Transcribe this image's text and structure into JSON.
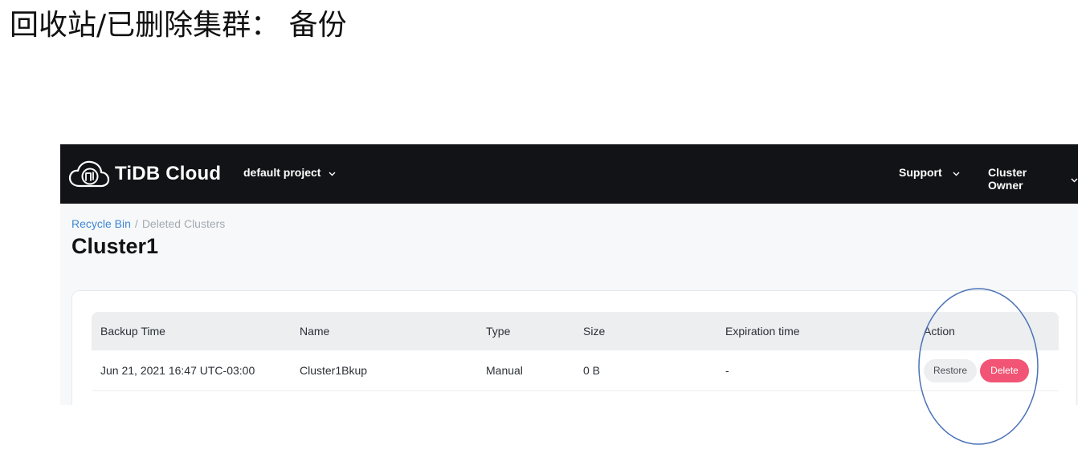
{
  "slide": {
    "title": "回收站/已删除集群：  备份",
    "annotation_color": "#4a72b8"
  },
  "app": {
    "logo_text": "TiDB Cloud",
    "project_selector": "default project",
    "support_menu": "Support",
    "user_menu": "Cluster Owner",
    "colors": {
      "topbar": "#121316",
      "link": "#3f86d4",
      "delete": "#f15474"
    }
  },
  "breadcrumb": {
    "parent": "Recycle Bin",
    "separator": "/",
    "current": "Deleted Clusters"
  },
  "page_title": "Cluster1",
  "table": {
    "headers": [
      "Backup Time",
      "Name",
      "Type",
      "Size",
      "Expiration time",
      "Action"
    ],
    "rows": [
      {
        "backup_time": "Jun 21, 2021 16:47 UTC-03:00",
        "name": "Cluster1Bkup",
        "type": "Manual",
        "size": "0 B",
        "expiration": "-",
        "restore_label": "Restore",
        "delete_label": "Delete"
      }
    ]
  }
}
